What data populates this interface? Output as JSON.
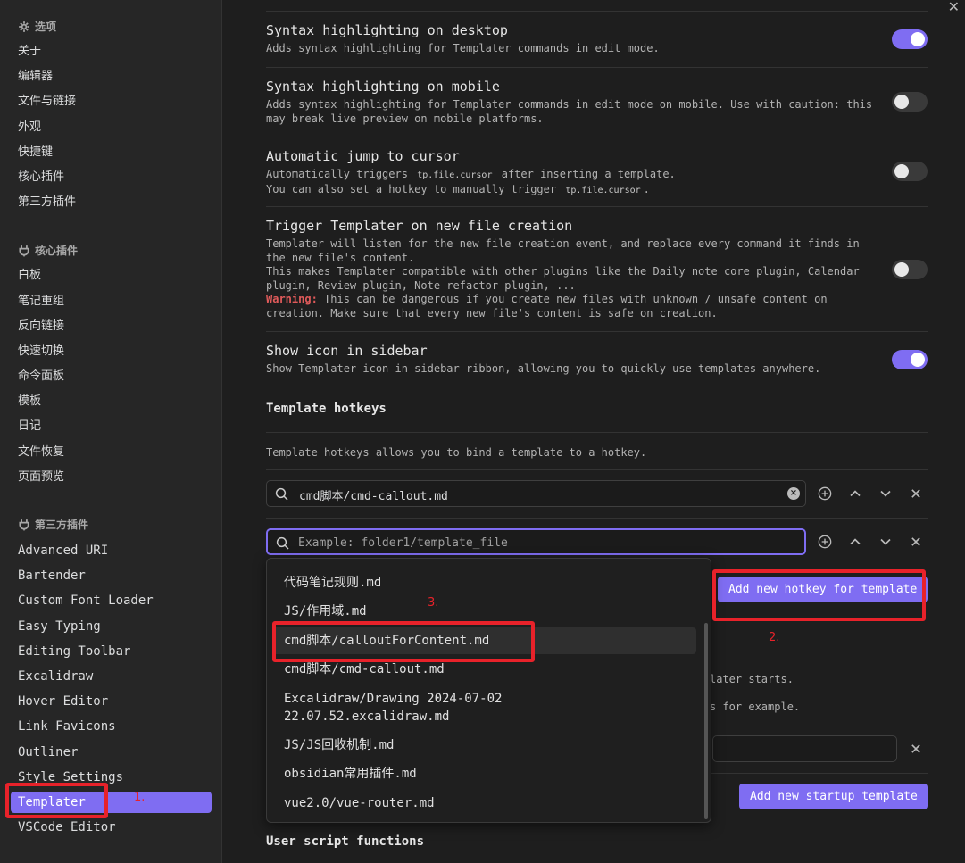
{
  "sidebar": {
    "options_header": "选项",
    "options": [
      "关于",
      "编辑器",
      "文件与链接",
      "外观",
      "快捷键",
      "核心插件",
      "第三方插件"
    ],
    "core_header": "核心插件",
    "core_plugins": [
      "白板",
      "笔记重组",
      "反向链接",
      "快速切换",
      "命令面板",
      "模板",
      "日记",
      "文件恢复",
      "页面预览"
    ],
    "community_header": "第三方插件",
    "community_plugins": [
      "Advanced URI",
      "Bartender",
      "Custom Font Loader",
      "Easy Typing",
      "Editing Toolbar",
      "Excalidraw",
      "Hover Editor",
      "Link Favicons",
      "Outliner",
      "Style Settings",
      "Templater",
      "VSCode Editor"
    ],
    "active_plugin": "Templater"
  },
  "settings": {
    "syntax_desktop": {
      "name": "Syntax highlighting on desktop",
      "desc": "Adds syntax highlighting for Templater commands in edit mode.",
      "enabled": true
    },
    "syntax_mobile": {
      "name": "Syntax highlighting on mobile",
      "desc1": "Adds syntax highlighting for Templater commands in edit mode on mobile. Use with caution: this",
      "desc2": "may break live preview on mobile platforms.",
      "enabled": false
    },
    "auto_jump": {
      "name": "Automatic jump to cursor",
      "desc1a": "Automatically triggers",
      "code1": "tp.file.cursor",
      "desc1b": "after inserting a template.",
      "desc2a": "You can also set a hotkey to manually trigger",
      "code2": "tp.file.cursor",
      "desc2b": ".",
      "enabled": false
    },
    "trigger_new": {
      "name": "Trigger Templater on new file creation",
      "desc1": "Templater will listen for the new file creation event, and replace every command it finds in",
      "desc2": "the new file's content.",
      "desc3": "This makes Templater compatible with other plugins like the Daily note core plugin, Calendar",
      "desc4": "plugin, Review plugin, Note refactor plugin, ...",
      "warn_label": "Warning:",
      "warn_text": "This can be dangerous if you create new files with unknown / unsafe content on",
      "desc6": "creation. Make sure that every new file's content is safe on creation.",
      "enabled": false
    },
    "show_icon": {
      "name": "Show icon in sidebar",
      "desc": "Show Templater icon in sidebar ribbon, allowing you to quickly use templates anywhere.",
      "enabled": true
    }
  },
  "hotkeys": {
    "heading": "Template hotkeys",
    "desc": "Template hotkeys allows you to bind a template to a hotkey.",
    "entry1_value": "cmd脚本/cmd-callout.md",
    "entry2_placeholder": "Example: folder1/template_file",
    "add_button": "Add new hotkey for template"
  },
  "startup": {
    "partial1": "later starts.",
    "partial2": "s for example.",
    "add_button": "Add new startup template"
  },
  "user_scripts_heading": "User script functions",
  "dropdown": {
    "items": [
      "代码笔记规则.md",
      "JS/作用域.md",
      "cmd脚本/calloutForContent.md",
      "cmd脚本/cmd-callout.md",
      "Excalidraw/Drawing 2024-07-02",
      "22.07.52.excalidraw.md",
      "JS/JS回收机制.md",
      "obsidian常用插件.md",
      "vue2.0/vue-router.md"
    ],
    "selected": "cmd脚本/calloutForContent.md"
  },
  "annotations": [
    "1.",
    "2.",
    "3."
  ],
  "colors": {
    "accent": "#7f6df2",
    "annotation": "#e8222a",
    "warning": "#e05a5a"
  }
}
